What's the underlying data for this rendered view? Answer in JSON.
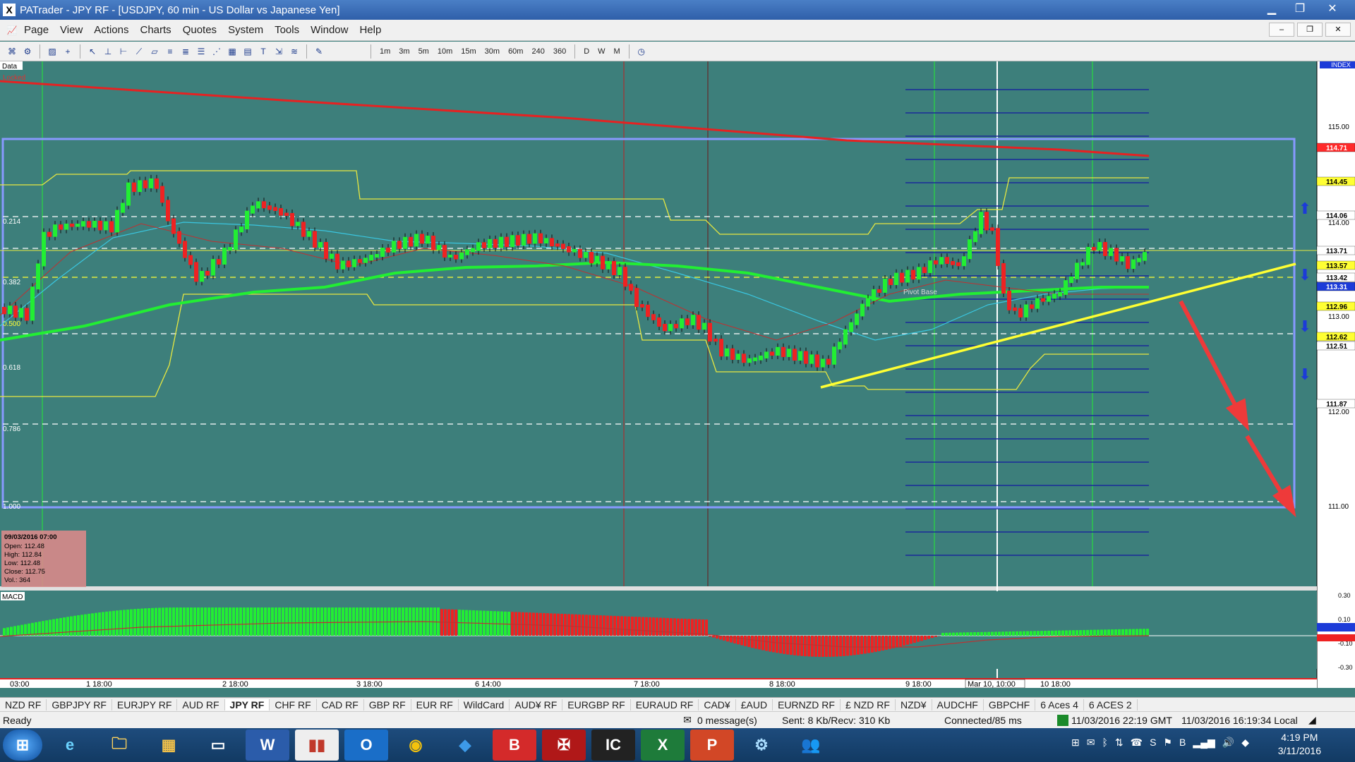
{
  "window": {
    "title": "PATrader - JPY RF - [USDJPY, 60 min - US Dollar vs Japanese Yen]"
  },
  "menu": [
    "Page",
    "View",
    "Actions",
    "Charts",
    "Quotes",
    "System",
    "Tools",
    "Window",
    "Help"
  ],
  "timeframes": [
    "1m",
    "3m",
    "5m",
    "10m",
    "15m",
    "30m",
    "60m",
    "240",
    "360",
    "D",
    "W",
    "M"
  ],
  "chart": {
    "data_label": "Data",
    "locked_label": "Locked",
    "index_label": "INDEX",
    "fib_labels": [
      "0.214",
      "0.382",
      "0.500",
      "0.618",
      "0.786",
      "1.000"
    ],
    "price_ticks": [
      "115.00",
      "114.00",
      "113.00",
      "112.00",
      "111.00"
    ],
    "price_tags": [
      {
        "text": "114.71",
        "bg": "#ff2a2a",
        "fg": "#ffffff"
      },
      {
        "text": "114.45",
        "bg": "#ffff33",
        "fg": "#000000"
      },
      {
        "text": "114.06",
        "bg": "#ffffff",
        "fg": "#000000"
      },
      {
        "text": "113.71",
        "bg": "#ffffff",
        "fg": "#000000"
      },
      {
        "text": "113.57",
        "bg": "#ffff33",
        "fg": "#000000"
      },
      {
        "text": "113.42",
        "bg": "#ffffff",
        "fg": "#000000"
      },
      {
        "text": "113.31",
        "bg": "#1c3bd8",
        "fg": "#ffffff"
      },
      {
        "text": "112.96",
        "bg": "#ffff33",
        "fg": "#000000"
      },
      {
        "text": "112.62",
        "bg": "#ffff33",
        "fg": "#000000"
      },
      {
        "text": "112.51",
        "bg": "#ffffff",
        "fg": "#000000"
      },
      {
        "text": "111.87",
        "bg": "#ffffff",
        "fg": "#000000"
      }
    ],
    "time_labels": [
      "03:00",
      "1 18:00",
      "2 18:00",
      "3 18:00",
      "6 14:00",
      "7 18:00",
      "8 18:00",
      "9 18:00",
      "Mar 10, 10:00",
      "10 18:00"
    ],
    "ohlc": {
      "date": "09/03/2016 07:00",
      "open": "Open: 112.48",
      "high": "High: 112.84",
      "low": "Low: 112.48",
      "close": "Close: 112.75",
      "vol": "Vol.: 364"
    },
    "pivot_label": "Pivot Base",
    "macd_label": "MACD",
    "macd_ticks": [
      "0.30",
      "0.10",
      "-0.10",
      "-0.30"
    ],
    "colors": {
      "background": "#3d7f7b",
      "bull": "#22ee33",
      "bear": "#ee2222",
      "fib_box": "#8899ff",
      "trend": "#ffff33"
    }
  },
  "tabs": [
    "NZD RF",
    "GBPJPY RF",
    "EURJPY RF",
    "AUD RF",
    "JPY RF",
    "CHF RF",
    "CAD RF",
    "GBP RF",
    "EUR RF",
    "WildCard",
    "AUD¥ RF",
    "EURGBP RF",
    "EURAUD RF",
    "CAD¥",
    "£AUD",
    "EURNZD RF",
    "£ NZD RF",
    "NZD¥",
    "AUDCHF",
    "GBPCHF",
    "6 Aces 4",
    "6 ACES 2"
  ],
  "active_tab": "JPY RF",
  "status": {
    "ready": "Ready",
    "messages": "0 message(s)",
    "traffic": "Sent: 8 Kb/Recv: 310 Kb",
    "connection": "Connected/85 ms",
    "gmt": "11/03/2016 22:19 GMT",
    "local": "11/03/2016 16:19:34 Local"
  },
  "taskbar": {
    "time": "4:19 PM",
    "date": "3/11/2016"
  }
}
